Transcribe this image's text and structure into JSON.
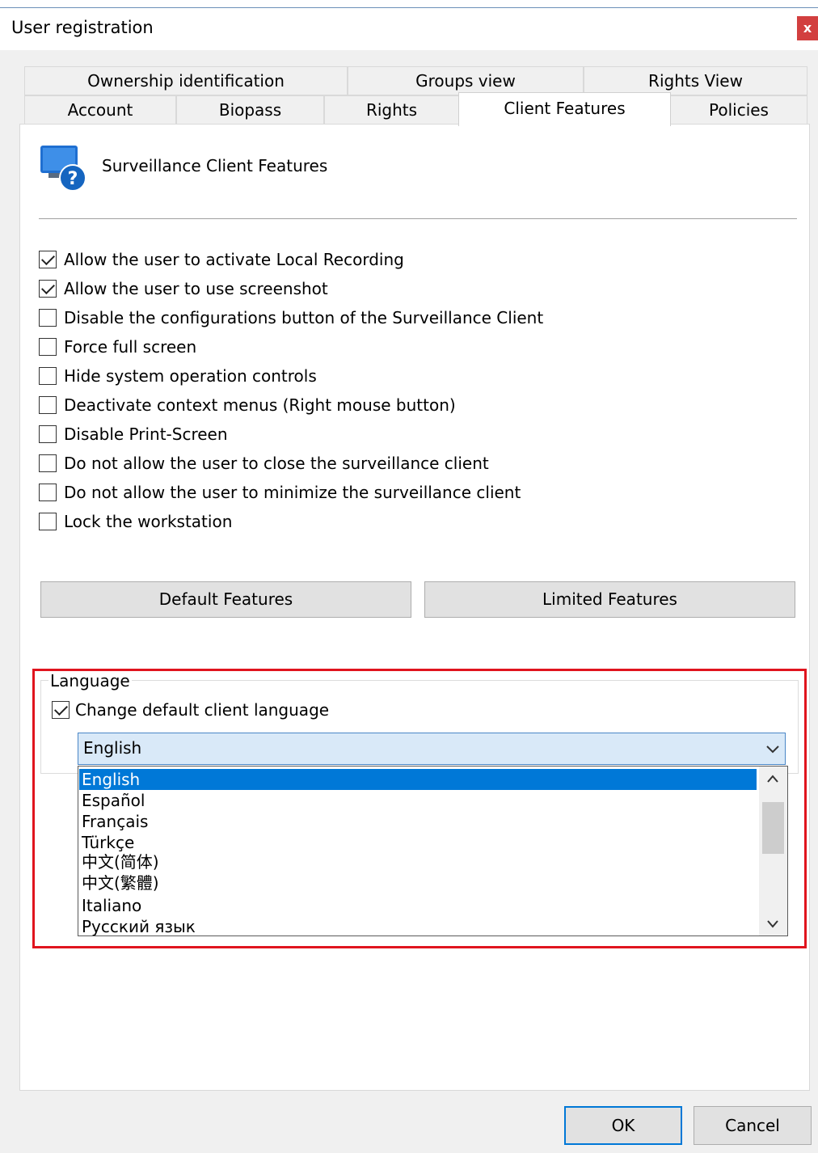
{
  "window": {
    "title": "User registration",
    "close_label": "x"
  },
  "tabs": {
    "row1": [
      "Ownership identification",
      "Groups view",
      "Rights View"
    ],
    "row2": [
      "Account",
      "Biopass",
      "Rights",
      "Client Features",
      "Policies"
    ],
    "active": "Client Features"
  },
  "panel": {
    "title": "Surveillance Client Features",
    "icon": "monitor-help-icon"
  },
  "options": [
    {
      "label": "Allow the user to activate Local Recording",
      "checked": true
    },
    {
      "label": "Allow the user to use screenshot",
      "checked": true
    },
    {
      "label": "Disable the configurations button of the Surveillance Client",
      "checked": false
    },
    {
      "label": "Force full screen",
      "checked": false
    },
    {
      "label": "Hide system operation controls",
      "checked": false
    },
    {
      "label": "Deactivate context menus (Right mouse button)",
      "checked": false
    },
    {
      "label": "Disable Print-Screen",
      "checked": false
    },
    {
      "label": "Do not allow the user to close the surveillance client",
      "checked": false
    },
    {
      "label": "Do not allow the user to minimize the surveillance client",
      "checked": false
    },
    {
      "label": "Lock the workstation",
      "checked": false
    }
  ],
  "buttons": {
    "default_features": "Default Features",
    "limited_features": "Limited Features",
    "ok": "OK",
    "cancel": "Cancel"
  },
  "language": {
    "group_label": "Language",
    "change_label": "Change default client language",
    "change_checked": true,
    "selected": "English",
    "options": [
      "English",
      "Español",
      "Français",
      "Türkçe",
      "中文(简体)",
      "中文(繁體)",
      "Italiano",
      "Русский язык"
    ]
  },
  "colors": {
    "accent": "#0078d7",
    "highlight_border": "#e0141e",
    "close_button": "#d23f3f"
  }
}
